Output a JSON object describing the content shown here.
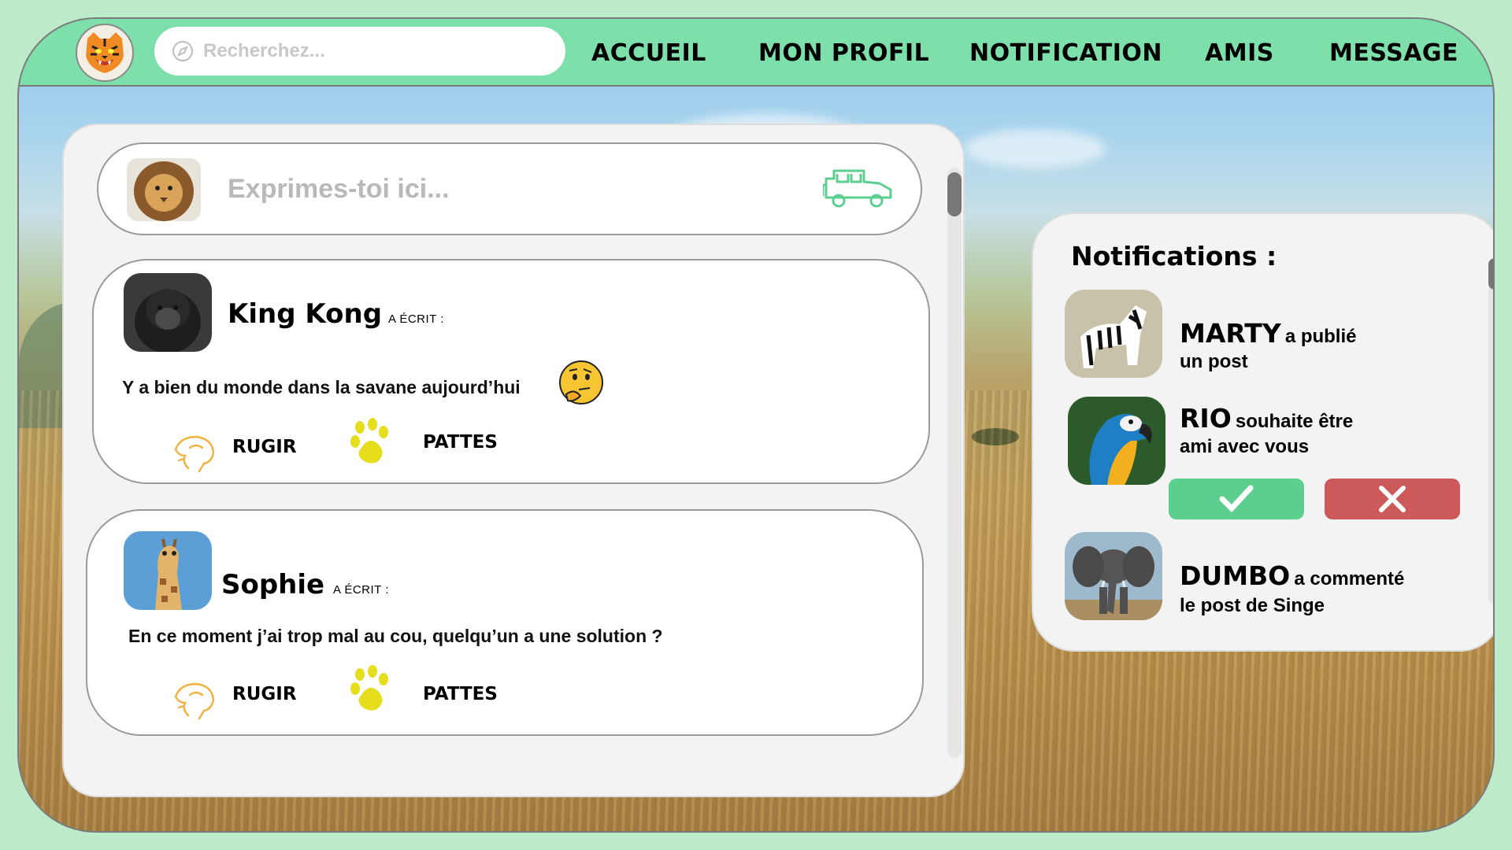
{
  "search": {
    "placeholder": "Recherchez..."
  },
  "nav": [
    "ACCUEIL",
    "MON PROFIL",
    "NOTIFICATION",
    "AMIS",
    "MESSAGE"
  ],
  "composer": {
    "placeholder": "Exprimes-toi ici..."
  },
  "posts": [
    {
      "author": "King Kong",
      "wrote": "A ÉCRIT :",
      "text": "Y a bien du monde dans la savane aujourd’hui",
      "emoji": "🤔",
      "action1": "RUGIR",
      "action2": "PATTES"
    },
    {
      "author": "Sophie",
      "wrote": "A ÉCRIT :",
      "text": "En ce moment j’ai trop mal au cou, quelqu’un a une solution ?",
      "action1": "RUGIR",
      "action2": "PATTES"
    }
  ],
  "notifications": {
    "title": "Notifications :",
    "items": [
      {
        "name": "MARTY",
        "text1": "a publié",
        "text2": "un post"
      },
      {
        "name": "RIO",
        "text1": "souhaite être",
        "text2": "ami avec vous"
      },
      {
        "name": "DUMBO",
        "text1": "a commenté",
        "text2": "le post de Singe"
      }
    ]
  },
  "colors": {
    "nav_green": "#7ddfa9",
    "accept_green": "#5ccf8f",
    "decline_red": "#cc5a5a",
    "paw_yellow": "#e6dd1c",
    "roar_orange": "#f0b341"
  },
  "icons": [
    "tiger-logo-icon",
    "compass-icon",
    "jeep-icon",
    "roar-icon",
    "paw-icon",
    "check-icon",
    "close-icon"
  ]
}
